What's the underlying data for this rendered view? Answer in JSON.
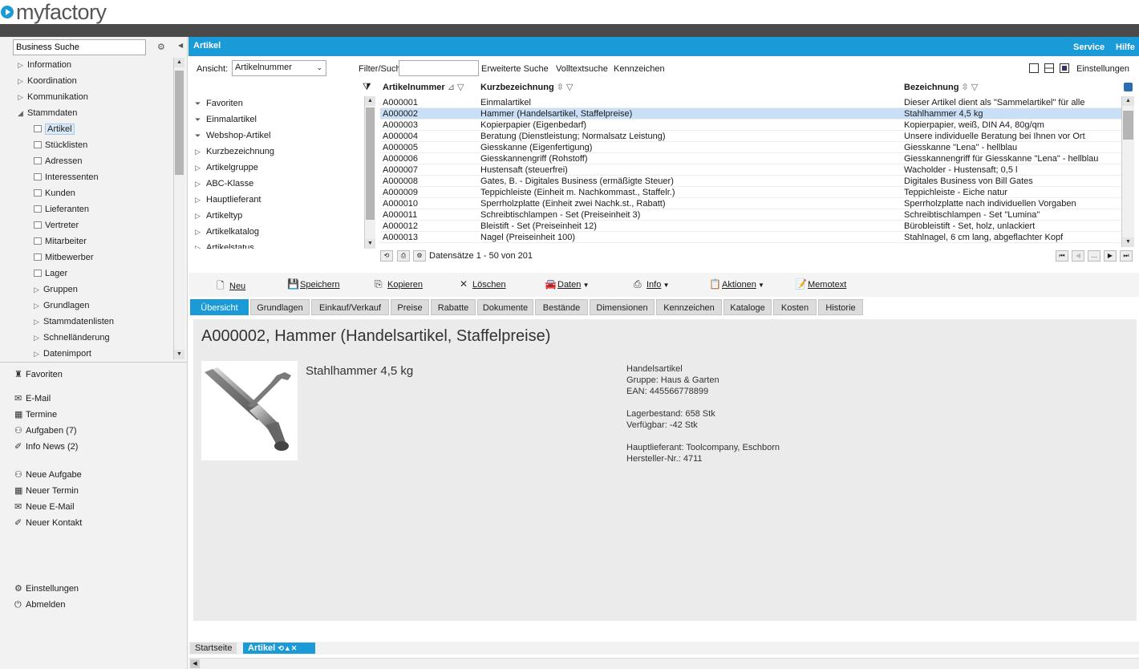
{
  "app": {
    "logo_text": "myfactory"
  },
  "left": {
    "search_value": "Business Suche",
    "nav": [
      {
        "label": "Information",
        "expanded": false
      },
      {
        "label": "Koordination",
        "expanded": false
      },
      {
        "label": "Kommunikation",
        "expanded": false
      },
      {
        "label": "Stammdaten",
        "expanded": true
      },
      {
        "label": "Artikel",
        "selected": true
      },
      {
        "label": "Stücklisten"
      },
      {
        "label": "Adressen"
      },
      {
        "label": "Interessenten"
      },
      {
        "label": "Kunden"
      },
      {
        "label": "Lieferanten"
      },
      {
        "label": "Vertreter"
      },
      {
        "label": "Mitarbeiter"
      },
      {
        "label": "Mitbewerber"
      },
      {
        "label": "Lager"
      },
      {
        "label": "Gruppen"
      },
      {
        "label": "Grundlagen"
      },
      {
        "label": "Stammdatenlisten"
      },
      {
        "label": "Schnelländerung"
      },
      {
        "label": "Datenimport"
      }
    ],
    "favoriten": "Favoriten",
    "quick": [
      "E-Mail",
      "Termine",
      "Aufgaben (7)",
      "Info News (2)"
    ],
    "new": [
      "Neue Aufgabe",
      "Neuer Termin",
      "Neue E-Mail",
      "Neuer Kontakt"
    ],
    "bottom": [
      "Einstellungen",
      "Abmelden"
    ]
  },
  "topbar": {
    "title": "Artikel",
    "service": "Service",
    "hilfe": "Hilfe"
  },
  "filter": {
    "ansicht_label": "Ansicht:",
    "ansicht_value": "Artikelnummer",
    "filter_label": "Filter/Suche:",
    "erweiterte": "Erweiterte Suche",
    "volltext": "Volltextsuche",
    "kennzeichen": "Kennzeichen",
    "einstellungen": "Einstellungen"
  },
  "filterlist": [
    "Favoriten",
    "Einmalartikel",
    "Webshop-Artikel",
    "Kurzbezeichnung",
    "Artikelgruppe",
    "ABC-Klasse",
    "Hauptlieferant",
    "Artikeltyp",
    "Artikelkatalog",
    "Artikelstatus"
  ],
  "grid": {
    "headers": [
      "Artikelnummer",
      "Kurzbezeichnung",
      "Bezeichnung"
    ],
    "rows": [
      [
        "A000001",
        "Einmalartikel",
        "Dieser Artikel dient als \"Sammelartikel\" für alle"
      ],
      [
        "A000002",
        "Hammer (Handelsartikel, Staffelpreise)",
        "Stahlhammer 4,5 kg"
      ],
      [
        "A000003",
        "Kopierpapier (Eigenbedarf)",
        "Kopierpapier, weiß, DIN A4, 80g/qm"
      ],
      [
        "A000004",
        "Beratung (Dienstleistung; Normalsatz Leistung)",
        "Unsere individuelle Beratung bei Ihnen vor Ort"
      ],
      [
        "A000005",
        "Giesskanne (Eigenfertigung)",
        "Giesskanne \"Lena\" - hellblau"
      ],
      [
        "A000006",
        "Giesskannengriff (Rohstoff)",
        "Giesskannengriff für Giesskanne \"Lena\" - hellblau"
      ],
      [
        "A000007",
        "Hustensaft (steuerfrei)",
        "Wacholder - Hustensaft; 0,5 l"
      ],
      [
        "A000008",
        "Gates, B. - Digitales Business (ermäßigte Steuer)",
        "Digitales Business von Bill Gates"
      ],
      [
        "A000009",
        "Teppichleiste (Einheit m. Nachkommast., Staffelr.)",
        "Teppichleiste - Eiche natur"
      ],
      [
        "A000010",
        "Sperrholzplatte (Einheit zwei Nachk.st., Rabatt)",
        "Sperrholzplatte nach individuellen Vorgaben"
      ],
      [
        "A000011",
        "Schreibtischlampen - Set (Preiseinheit 3)",
        "Schreibtischlampen - Set \"Lumina\""
      ],
      [
        "A000012",
        "Bleistift - Set (Preiseinheit 12)",
        "Bürobleistift - Set, holz, unlackiert"
      ],
      [
        "A000013",
        "Nagel (Preiseinheit 100)",
        "Stahlnagel, 6 cm lang, abgeflachter Kopf"
      ]
    ],
    "footer": "Datensätze 1 - 50 von 201"
  },
  "actions": [
    "Neu",
    "Speichern",
    "Kopieren",
    "Löschen",
    "Daten",
    "Info",
    "Aktionen",
    "Memotext"
  ],
  "tabs": [
    "Übersicht",
    "Grundlagen",
    "Einkauf/Verkauf",
    "Preise",
    "Rabatte",
    "Dokumente",
    "Bestände",
    "Dimensionen",
    "Kennzeichen",
    "Kataloge",
    "Kosten",
    "Historie"
  ],
  "detail": {
    "title": "A000002, Hammer (Handelsartikel, Staffelpreise)",
    "subtitle": "Stahlhammer 4,5 kg",
    "info": [
      "Handelsartikel",
      "Gruppe: Haus & Garten",
      "EAN: 445566778899",
      "",
      "Lagerbestand: 658 Stk",
      "Verfügbar: -42 Stk",
      "",
      "Hauptlieferant: Toolcompany, Eschborn",
      "Hersteller-Nr.: 4711"
    ]
  },
  "bottomtabs": {
    "start": "Startseite",
    "artikel": "Artikel"
  },
  "colors": {
    "accent": "#1a9ad6",
    "darkbar": "#4a4a4a"
  }
}
